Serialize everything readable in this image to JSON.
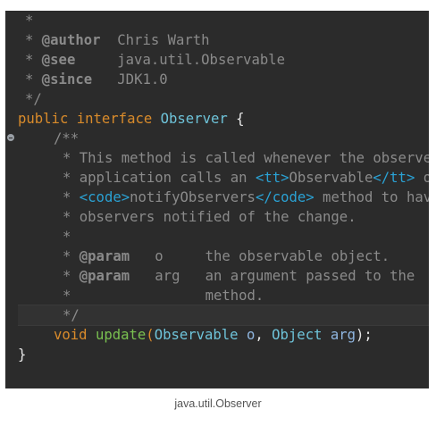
{
  "code": {
    "l1": {
      "star": "*"
    },
    "l2": {
      "star": "* ",
      "tag": "@author",
      "text": "  Chris Warth"
    },
    "l3": {
      "star": "* ",
      "tag": "@see",
      "text": "     java.util.Observable"
    },
    "l4": {
      "star": "* ",
      "tag": "@since",
      "text": "   JDK1.0"
    },
    "l5": {
      "star": "*/"
    },
    "l6": {
      "kw1": "public",
      "kw2": "interface",
      "name": "Observer",
      "brace": "{"
    },
    "l7": {
      "text": "/**"
    },
    "l8": {
      "text": "* This method is called whenever the observed object is changed. An"
    },
    "l9": {
      "pre": "* application calls an ",
      "tag_open": "<tt>",
      "text": "Observable",
      "tag_close": "</tt>",
      "post": " object's"
    },
    "l10": {
      "pre": "* ",
      "tag_open": "<code>",
      "text": "notifyObservers",
      "tag_close": "</code>",
      "post": " method to have all the object's"
    },
    "l11": {
      "text": "* observers notified of the change."
    },
    "l12": {
      "text": "*"
    },
    "l13": {
      "star": "* ",
      "tag": "@param",
      "text": "   o     the observable object."
    },
    "l14": {
      "star": "* ",
      "tag": "@param",
      "text": "   arg   an argument passed to the"
    },
    "l15": {
      "text": "*                method."
    },
    "l16": {
      "text": "*/"
    },
    "l17": {
      "kw": "void",
      "method": "update",
      "paren_open": "(",
      "type1": "Observable",
      "p1": " o",
      "comma": ", ",
      "type2": "Object",
      "p2": " arg",
      "close": ");"
    },
    "l18": {
      "brace": "}"
    }
  },
  "caption": "java.util.Observer"
}
